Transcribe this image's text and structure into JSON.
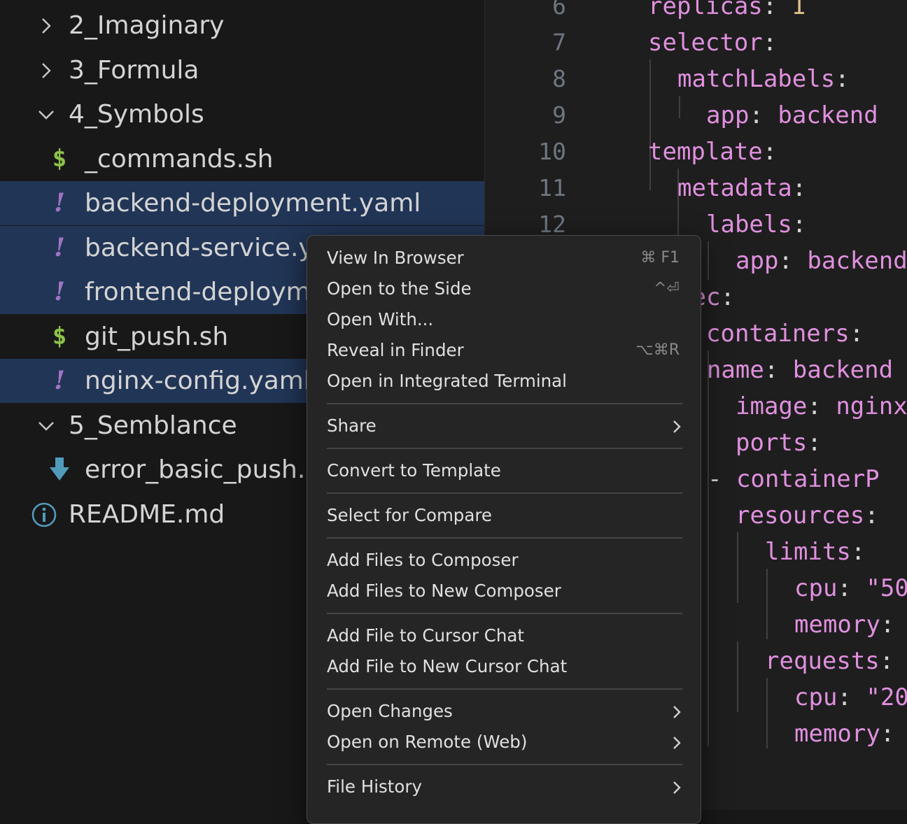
{
  "explorer": {
    "items": [
      {
        "label": "2_Imaginary",
        "type": "folder",
        "expanded": false
      },
      {
        "label": "3_Formula",
        "type": "folder",
        "expanded": false
      },
      {
        "label": "4_Symbols",
        "type": "folder",
        "expanded": true
      },
      {
        "label": "_commands.sh",
        "type": "sh",
        "icon_glyph": "$",
        "selected": false
      },
      {
        "label": "backend-deployment.yaml",
        "type": "yaml",
        "icon_glyph": "!",
        "selected": true
      },
      {
        "label": "backend-service.y",
        "type": "yaml",
        "icon_glyph": "!",
        "selected": true
      },
      {
        "label": "frontend-deploym",
        "type": "yaml",
        "icon_glyph": "!",
        "selected": true
      },
      {
        "label": "git_push.sh",
        "type": "sh",
        "icon_glyph": "$",
        "selected": false
      },
      {
        "label": "nginx-config.yaml",
        "type": "yaml",
        "icon_glyph": "!",
        "selected": true
      },
      {
        "label": "5_Semblance",
        "type": "folder",
        "expanded": true
      },
      {
        "label": "error_basic_push.",
        "type": "download",
        "icon": "download-arrow-icon",
        "selected": false
      },
      {
        "label": "README.md",
        "type": "info",
        "icon": "info-icon",
        "selected": false
      }
    ]
  },
  "editor": {
    "line_numbers": [
      "6",
      "7",
      "8",
      "9",
      "10",
      "11",
      "12"
    ],
    "code": [
      {
        "tokens": [
          {
            "t": "replicas",
            "c": "k"
          },
          {
            "t": ": ",
            "c": "p"
          },
          {
            "t": "1",
            "c": "n"
          }
        ]
      },
      {
        "tokens": [
          {
            "t": "selector",
            "c": "k"
          },
          {
            "t": ":",
            "c": "p"
          }
        ]
      },
      {
        "tokens": [
          {
            "t": "matchLabels",
            "c": "k"
          },
          {
            "t": ":",
            "c": "p"
          }
        ]
      },
      {
        "tokens": [
          {
            "t": "app",
            "c": "k"
          },
          {
            "t": ": ",
            "c": "p"
          },
          {
            "t": "backend",
            "c": "k"
          }
        ]
      },
      {
        "tokens": [
          {
            "t": "template",
            "c": "k"
          },
          {
            "t": ":",
            "c": "p"
          }
        ]
      },
      {
        "tokens": [
          {
            "t": "metadata",
            "c": "k"
          },
          {
            "t": ":",
            "c": "p"
          }
        ]
      },
      {
        "tokens": [
          {
            "t": "labels",
            "c": "k"
          },
          {
            "t": ":",
            "c": "p"
          }
        ]
      },
      {
        "tokens": [
          {
            "t": "app",
            "c": "k"
          },
          {
            "t": ": ",
            "c": "p"
          },
          {
            "t": "backend",
            "c": "k"
          }
        ]
      },
      {
        "tokens": [
          {
            "t": "pec",
            "c": "k"
          },
          {
            "t": ":",
            "c": "p"
          }
        ]
      },
      {
        "tokens": [
          {
            "t": "containers",
            "c": "k"
          },
          {
            "t": ":",
            "c": "p"
          }
        ]
      },
      {
        "tokens": [
          {
            "t": "- ",
            "c": "p"
          },
          {
            "t": "name",
            "c": "k"
          },
          {
            "t": ": ",
            "c": "p"
          },
          {
            "t": "backend",
            "c": "k"
          }
        ]
      },
      {
        "tokens": [
          {
            "t": "image",
            "c": "k"
          },
          {
            "t": ": ",
            "c": "p"
          },
          {
            "t": "nginx",
            "c": "k"
          }
        ]
      },
      {
        "tokens": [
          {
            "t": "ports",
            "c": "k"
          },
          {
            "t": ":",
            "c": "p"
          }
        ]
      },
      {
        "tokens": [
          {
            "t": "- ",
            "c": "p"
          },
          {
            "t": "containerP",
            "c": "k"
          }
        ]
      },
      {
        "tokens": [
          {
            "t": "resources",
            "c": "k"
          },
          {
            "t": ":",
            "c": "p"
          }
        ]
      },
      {
        "tokens": [
          {
            "t": "limits",
            "c": "k"
          },
          {
            "t": ":",
            "c": "p"
          }
        ]
      },
      {
        "tokens": [
          {
            "t": "cpu",
            "c": "k"
          },
          {
            "t": ": ",
            "c": "p"
          },
          {
            "t": "\"50",
            "c": "k"
          }
        ]
      },
      {
        "tokens": [
          {
            "t": "memory",
            "c": "k"
          },
          {
            "t": ":",
            "c": "p"
          }
        ]
      },
      {
        "tokens": [
          {
            "t": "requests",
            "c": "k"
          },
          {
            "t": ":",
            "c": "p"
          }
        ]
      },
      {
        "tokens": [
          {
            "t": "cpu",
            "c": "k"
          },
          {
            "t": ": ",
            "c": "p"
          },
          {
            "t": "\"20",
            "c": "k"
          }
        ]
      },
      {
        "tokens": [
          {
            "t": "memory",
            "c": "k"
          },
          {
            "t": ":",
            "c": "p"
          }
        ]
      }
    ]
  },
  "context_menu": {
    "groups": [
      [
        {
          "label": "View In Browser",
          "shortcut": "⌘ F1"
        },
        {
          "label": "Open to the Side",
          "shortcut": "^⏎"
        },
        {
          "label": "Open With..."
        },
        {
          "label": "Reveal in Finder",
          "shortcut": "⌥⌘R"
        },
        {
          "label": "Open in Integrated Terminal"
        }
      ],
      [
        {
          "label": "Share",
          "submenu": true
        }
      ],
      [
        {
          "label": "Convert to Template"
        }
      ],
      [
        {
          "label": "Select for Compare"
        }
      ],
      [
        {
          "label": "Add Files to Composer"
        },
        {
          "label": "Add Files to New Composer"
        }
      ],
      [
        {
          "label": "Add File to Cursor Chat"
        },
        {
          "label": "Add File to New Cursor Chat"
        }
      ],
      [
        {
          "label": "Open Changes",
          "submenu": true
        },
        {
          "label": "Open on Remote (Web)",
          "submenu": true
        }
      ],
      [
        {
          "label": "File History",
          "submenu": true
        }
      ]
    ]
  },
  "colors": {
    "selection": "#213556",
    "yaml_icon": "#a074c4",
    "sh_icon": "#8dc149",
    "download_icon": "#519aba",
    "info_icon": "#519aba",
    "yaml_key": "#e090df",
    "yaml_number": "#e2c08d"
  }
}
